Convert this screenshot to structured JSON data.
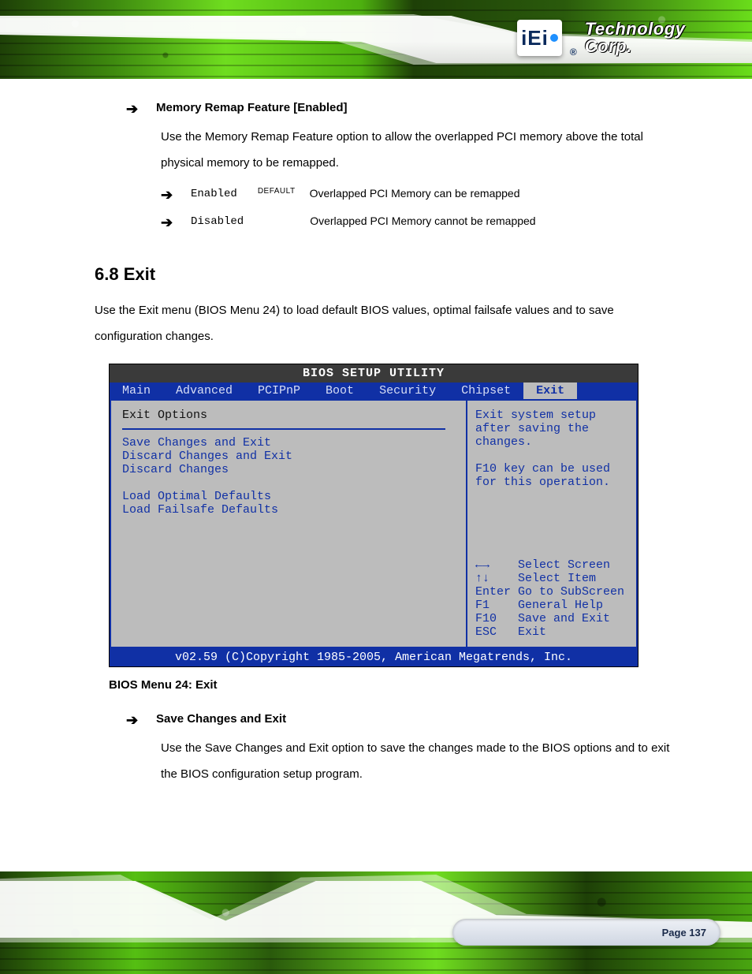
{
  "header": {
    "logo_letters": "iEi",
    "logo_registered": "®",
    "brand_text": "Technology Corp."
  },
  "doc": {
    "mmio_block": {
      "title": "Memory Remap Feature [Enabled]",
      "help": "Use the Memory Remap Feature option to allow the overlapped PCI memory above the total physical memory to be remapped.",
      "options": [
        {
          "value": "Enabled",
          "is_default": true,
          "default_tag": "DEFAULT",
          "note": "Overlapped PCI Memory can be remapped"
        },
        {
          "value": "Disabled",
          "is_default": false,
          "default_tag": "",
          "note": "Overlapped PCI Memory cannot be remapped"
        }
      ]
    },
    "exit_section": {
      "number_title": "6.8 Exit",
      "lead": "Use the Exit menu (BIOS Menu 24) to load default BIOS values, optimal failsafe values and to save configuration changes."
    },
    "bios_caption": "BIOS Menu 24: Exit",
    "save_block": {
      "title": "Save Changes and Exit",
      "help": "Use the Save Changes and Exit option to save the changes made to the BIOS options and to exit the BIOS configuration setup program."
    }
  },
  "bios": {
    "title": "BIOS SETUP UTILITY",
    "menu": [
      "Main",
      "Advanced",
      "PCIPnP",
      "Boot",
      "Security",
      "Chipset",
      "Exit"
    ],
    "menu_selected": "Exit",
    "left": {
      "header": "Exit Options",
      "items": [
        "Save Changes and Exit",
        "Discard Changes and Exit",
        "Discard Changes",
        "",
        "Load Optimal Defaults",
        "Load Failsafe Defaults"
      ]
    },
    "right": {
      "help_lines": [
        "Exit system setup",
        "after saving the",
        "changes.",
        "",
        "F10 key can be used",
        "for this operation."
      ],
      "keys": [
        {
          "k": "←→",
          "v": "Select Screen"
        },
        {
          "k": "↑↓",
          "v": "Select Item"
        },
        {
          "k": "Enter",
          "v": "Go to SubScreen"
        },
        {
          "k": "F1",
          "v": "General Help"
        },
        {
          "k": "F10",
          "v": "Save and Exit"
        },
        {
          "k": "ESC",
          "v": "Exit"
        }
      ]
    },
    "footer": "v02.59 (C)Copyright 1985-2005, American Megatrends, Inc."
  },
  "footer": {
    "page": "Page 137"
  }
}
